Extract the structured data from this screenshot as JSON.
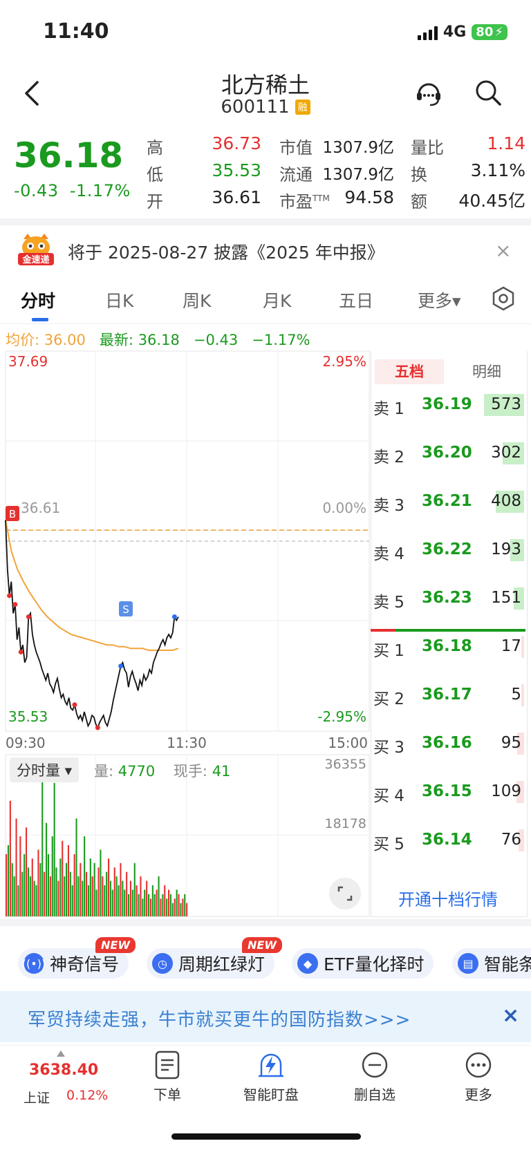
{
  "status": {
    "time": "11:40",
    "network": "4G",
    "battery": "80"
  },
  "header": {
    "name": "北方稀土",
    "code": "600111",
    "margin_badge": "融"
  },
  "quote": {
    "price": "36.18",
    "change": "-0.43",
    "change_pct": "-1.17%",
    "high_label": "高",
    "high": "36.73",
    "low_label": "低",
    "low": "35.53",
    "open_label": "开",
    "open": "36.61",
    "mktcap_label": "市值",
    "mktcap": "1307.9亿",
    "float_label": "流通",
    "float": "1307.9亿",
    "pe_label": "市盈",
    "pe_sup": "TTM",
    "pe": "94.58",
    "volratio_label": "量比",
    "volratio": "1.14",
    "turnover_label": "换",
    "turnover": "3.11%",
    "amount_label": "额",
    "amount": "40.45亿"
  },
  "notice": {
    "icon_text": "金速递",
    "text": "将于 2025-08-27 披露《2025 年中报》",
    "close": "×"
  },
  "tabs": [
    {
      "label": "分时"
    },
    {
      "label": "日K"
    },
    {
      "label": "周K"
    },
    {
      "label": "月K"
    },
    {
      "label": "五日"
    },
    {
      "label": "更多▾"
    }
  ],
  "info_line": {
    "avg_label": "均价:",
    "avg": "36.00",
    "last_label": "最新:",
    "last": "36.18",
    "chg": "−0.43",
    "pct": "−1.17%"
  },
  "chart_data": {
    "type": "line",
    "title": "",
    "y_max_label": "37.69",
    "y_min_label": "35.53",
    "pct_max_label": "2.95%",
    "pct_min_label": "-2.95%",
    "prev_close_label": "36.61",
    "zero_pct_label": "0.00%",
    "ylim": [
      35.53,
      37.69
    ],
    "x_labels": [
      "09:30",
      "11:30",
      "15:00"
    ],
    "series": [
      {
        "values": [
          36.73,
          36.45,
          36.3,
          36.38,
          36.2,
          36.25,
          36.05,
          36.12,
          35.98,
          36.02,
          35.92,
          35.95,
          36.18,
          36.2,
          36.08,
          36.02,
          35.98,
          35.95,
          35.92,
          35.88,
          35.85,
          35.82,
          35.86,
          35.8,
          35.78,
          35.75,
          35.8,
          35.83,
          35.77,
          35.72,
          35.74,
          35.7,
          35.68,
          35.72,
          35.66,
          35.65,
          35.68,
          35.63,
          35.6,
          35.62,
          35.59,
          35.64,
          35.6,
          35.56,
          35.58,
          35.62,
          35.61,
          35.57,
          35.55,
          35.58,
          35.6,
          35.62,
          35.58,
          35.56,
          35.6,
          35.64,
          35.7,
          35.75,
          35.8,
          35.85,
          35.9,
          35.92,
          35.88,
          35.86,
          35.78,
          35.84,
          35.87,
          35.83,
          35.8,
          35.76,
          35.82,
          35.79,
          35.85,
          35.82,
          35.84,
          35.88,
          35.86,
          35.92,
          35.95,
          35.98,
          36.0,
          36.03,
          36.05,
          36.02,
          36.06,
          36.08,
          36.06,
          36.09,
          36.18,
          36.16,
          36.18
        ]
      },
      {
        "values": [
          36.73,
          36.55,
          36.45,
          36.38,
          36.32,
          36.27,
          36.22,
          36.18,
          36.15,
          36.12,
          36.1,
          36.08,
          36.07,
          36.06,
          36.05,
          36.04,
          36.03,
          36.02,
          36.02,
          36.01,
          36.01,
          36.0,
          36.0,
          36.0,
          35.99,
          35.99,
          35.99,
          35.99,
          35.99,
          36.0
        ]
      }
    ],
    "volume_panel": {
      "selector": "分时量 ▾",
      "vol_label": "量:",
      "vol": "4770",
      "hand_label": "现手:",
      "hand": "41",
      "max_label": "36355",
      "mid_label": "18178",
      "ylim": [
        0,
        36355
      ]
    },
    "volume_values": [
      14000,
      16000,
      26000,
      12000,
      9000,
      22000,
      7000,
      18000,
      10000,
      14000,
      20000,
      11000,
      9000,
      13000,
      8000,
      7000,
      15000,
      12000,
      34000,
      10000,
      21000,
      14000,
      9000,
      18000,
      30000,
      11000,
      8000,
      13000,
      17000,
      9000,
      12000,
      16000,
      10000,
      7000,
      14000,
      22000,
      9000,
      12000,
      8000,
      18000,
      10000,
      7000,
      13000,
      9000,
      12000,
      6000,
      11000,
      15000,
      9000,
      7000,
      10000,
      13000,
      8000,
      6000,
      11000,
      9000,
      7000,
      12000,
      8000,
      6000,
      10000,
      5000,
      8000,
      6000,
      12000,
      7000,
      5000,
      9000,
      4000,
      6000,
      8000,
      5000,
      4000,
      7000,
      5000,
      6000,
      9000,
      4000,
      5000,
      7000,
      4000,
      6000,
      5000,
      3000,
      4000,
      6000,
      5000,
      3000,
      4000,
      5000,
      3000
    ],
    "volume_colors": [
      "r",
      "g",
      "r",
      "g",
      "g",
      "r",
      "g",
      "r",
      "g",
      "g",
      "r",
      "g",
      "g",
      "r",
      "g",
      "g",
      "r",
      "g",
      "g",
      "r",
      "g",
      "g",
      "r",
      "g",
      "g",
      "g",
      "r",
      "g",
      "r",
      "g",
      "g",
      "r",
      "g",
      "g",
      "r",
      "g",
      "g",
      "r",
      "g",
      "g",
      "r",
      "g",
      "g",
      "r",
      "g",
      "g",
      "r",
      "g",
      "r",
      "g",
      "g",
      "r",
      "g",
      "g",
      "r",
      "g",
      "g",
      "r",
      "g",
      "g",
      "r",
      "g",
      "r",
      "g",
      "g",
      "r",
      "g",
      "r",
      "g",
      "g",
      "r",
      "g",
      "r",
      "g",
      "g",
      "r",
      "g",
      "r",
      "g",
      "r",
      "g",
      "r",
      "g",
      "g",
      "r",
      "g",
      "r",
      "g",
      "r",
      "g",
      "r"
    ]
  },
  "order_book": {
    "tab_five": "五档",
    "tab_detail": "明细",
    "asks": [
      {
        "label": "卖 5",
        "price": "36.23",
        "vol": "151",
        "fill": 0.26
      },
      {
        "label": "卖 4",
        "price": "36.22",
        "vol": "193",
        "fill": 0.34
      },
      {
        "label": "卖 3",
        "price": "36.21",
        "vol": "408",
        "fill": 0.71
      },
      {
        "label": "卖 2",
        "price": "36.20",
        "vol": "302",
        "fill": 0.53
      },
      {
        "label": "卖 1",
        "price": "36.19",
        "vol": "573",
        "fill": 1.0
      }
    ],
    "bids": [
      {
        "label": "买 1",
        "price": "36.18",
        "vol": "17",
        "fill": 0.03
      },
      {
        "label": "买 2",
        "price": "36.17",
        "vol": "5",
        "fill": 0.01
      },
      {
        "label": "买 3",
        "price": "36.16",
        "vol": "95",
        "fill": 0.17
      },
      {
        "label": "买 4",
        "price": "36.15",
        "vol": "109",
        "fill": 0.19
      },
      {
        "label": "买 5",
        "price": "36.14",
        "vol": "76",
        "fill": 0.13
      }
    ],
    "ten_level_link": "开通十档行情"
  },
  "features": [
    {
      "label": "神奇信号",
      "badge": "NEW"
    },
    {
      "label": "周期红绿灯",
      "badge": "NEW"
    },
    {
      "label": "ETF量化择时"
    },
    {
      "label": "智能条"
    }
  ],
  "promo": {
    "text": "军贸持续走强，牛市就买更牛的国防指数>>>",
    "close": "×"
  },
  "bottom_nav": {
    "index_value": "3638.40",
    "index_name": "上证",
    "index_pct": "0.12%",
    "items": [
      {
        "label": "下单"
      },
      {
        "label": "智能盯盘"
      },
      {
        "label": "删自选"
      },
      {
        "label": "更多"
      }
    ]
  },
  "colors": {
    "up": "#e5302f",
    "down": "#1a9a1e",
    "accent": "#2a6ee8",
    "avg_line": "#f2a33a"
  }
}
